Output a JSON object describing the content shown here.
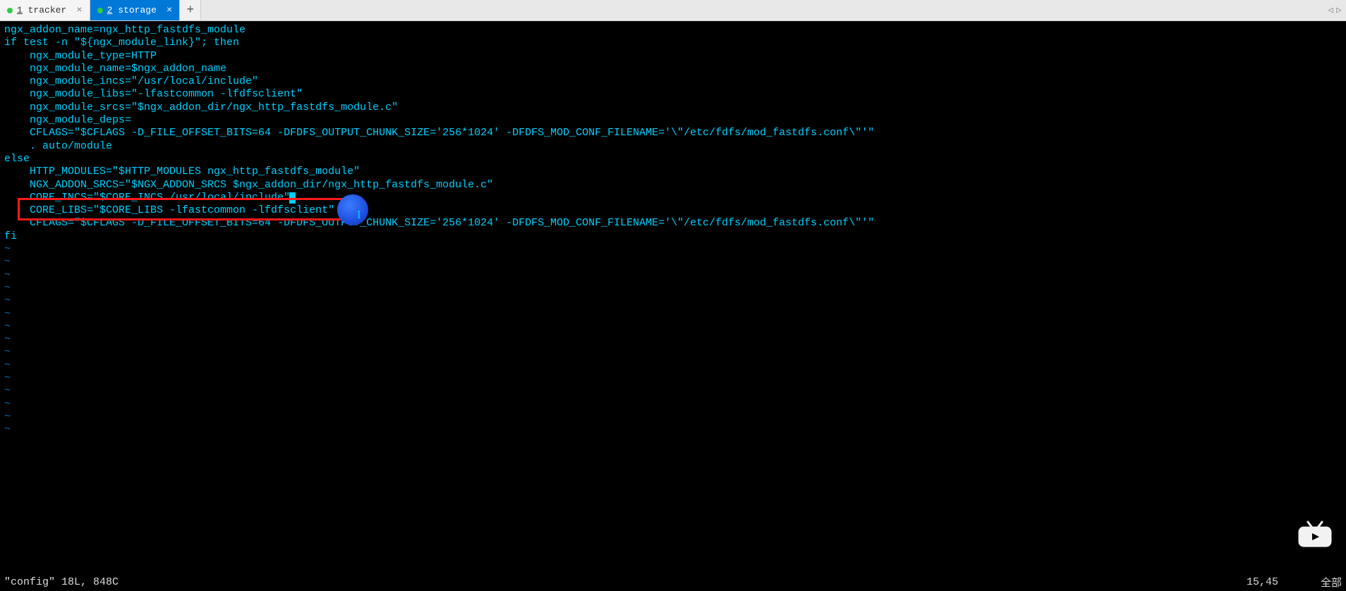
{
  "tabs": [
    {
      "number": "1",
      "label": "tracker",
      "active": false
    },
    {
      "number": "2",
      "label": "storage",
      "active": true
    }
  ],
  "new_tab_label": "+",
  "nav": {
    "prev": "◁",
    "next": "▷"
  },
  "editor": {
    "lines": [
      "ngx_addon_name=ngx_http_fastdfs_module",
      "",
      "if test -n \"${ngx_module_link}\"; then",
      "    ngx_module_type=HTTP",
      "    ngx_module_name=$ngx_addon_name",
      "    ngx_module_incs=\"/usr/local/include\"",
      "    ngx_module_libs=\"-lfastcommon -lfdfsclient\"",
      "    ngx_module_srcs=\"$ngx_addon_dir/ngx_http_fastdfs_module.c\"",
      "    ngx_module_deps=",
      "    CFLAGS=\"$CFLAGS -D_FILE_OFFSET_BITS=64 -DFDFS_OUTPUT_CHUNK_SIZE='256*1024' -DFDFS_MOD_CONF_FILENAME='\\\"/etc/fdfs/mod_fastdfs.conf\\\"'\"",
      "    . auto/module",
      "else",
      "    HTTP_MODULES=\"$HTTP_MODULES ngx_http_fastdfs_module\"",
      "    NGX_ADDON_SRCS=\"$NGX_ADDON_SRCS $ngx_addon_dir/ngx_http_fastdfs_module.c\"",
      "    CORE_INCS=\"$CORE_INCS /usr/local/include\"",
      "    CORE_LIBS=\"$CORE_LIBS -lfastcommon -lfdfsclient\"",
      "    CFLAGS=\"$CFLAGS -D_FILE_OFFSET_BITS=64 -DFDFS_OUTPUT_CHUNK_SIZE='256*1024' -DFDFS_MOD_CONF_FILENAME='\\\"/etc/fdfs/mod_fastdfs.conf\\\"'\"",
      "fi"
    ],
    "tilde": "~",
    "empty_rows": 15
  },
  "status": {
    "left": "\"config\" 18L, 848C",
    "position": "15,45",
    "right": "全部"
  },
  "highlight": {
    "line_index": 14,
    "cursor_after": true
  }
}
